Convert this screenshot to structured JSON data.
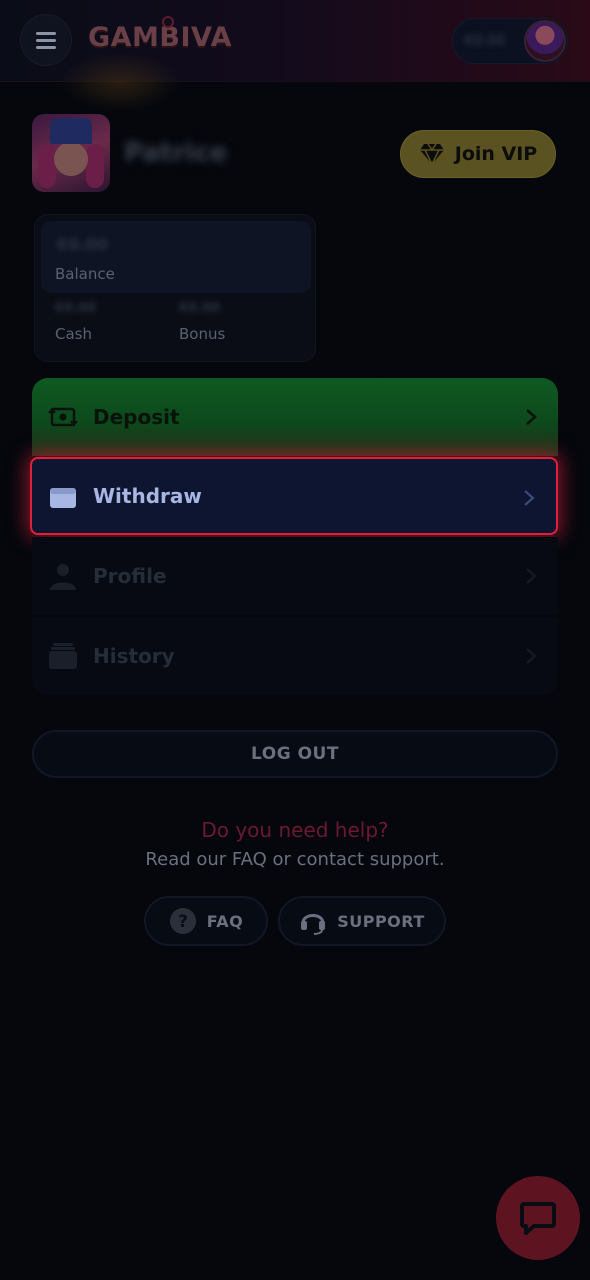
{
  "app": {
    "logo_text": "GAMBIVA"
  },
  "header": {
    "balance_amount": "€0.00"
  },
  "profile": {
    "username": "Patrice",
    "vip_label": "Join VIP"
  },
  "balance_card": {
    "balance_value": "€0.00",
    "balance_label": "Balance",
    "cash_value": "€0.00",
    "cash_label": "Cash",
    "bonus_value": "€0.00",
    "bonus_label": "Bonus"
  },
  "menu": {
    "items": [
      {
        "label": "Deposit",
        "icon": "money-transfer-icon"
      },
      {
        "label": "Withdraw",
        "icon": "wallet-icon"
      },
      {
        "label": "Profile",
        "icon": "user-icon"
      },
      {
        "label": "History",
        "icon": "history-icon"
      }
    ]
  },
  "logout_label": "LOG OUT",
  "help": {
    "title": "Do you need help?",
    "subtitle": "Read our FAQ or contact support.",
    "faq_label": "FAQ",
    "support_label": "SUPPORT"
  },
  "colors": {
    "accent_red": "#e0203a",
    "deposit_green": "#0e5a22",
    "vip_gold": "#5a5220"
  }
}
